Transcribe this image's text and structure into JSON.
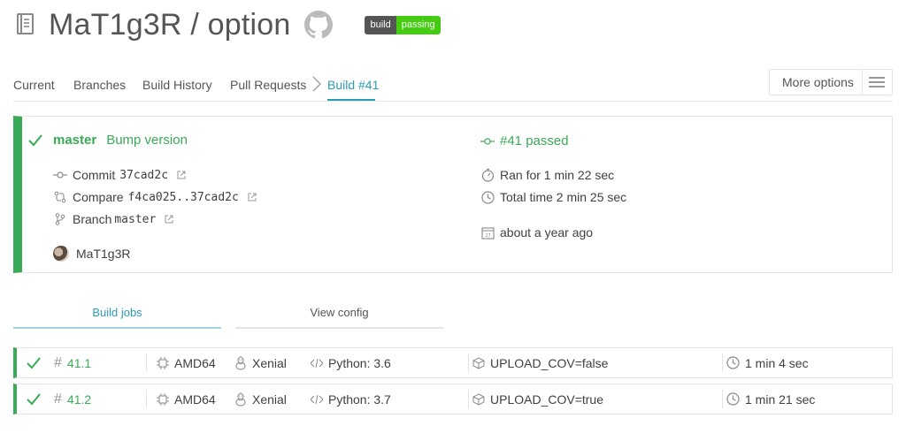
{
  "header": {
    "repo_title": "MaT1g3R / option",
    "badge_left": "build",
    "badge_right": "passing"
  },
  "tabs": {
    "current": "Current",
    "branches": "Branches",
    "build_history": "Build History",
    "pull_requests": "Pull Requests",
    "build": "Build #41",
    "more_options": "More options"
  },
  "build": {
    "branch": "master",
    "message": "Bump version",
    "status": "#41 passed",
    "commit_label": "Commit",
    "commit_sha": "37cad2c",
    "compare_label": "Compare",
    "compare_range": "f4ca025..37cad2c",
    "branch_label": "Branch",
    "branch_value": "master",
    "author": "MaT1g3R",
    "ran_for": "Ran for 1 min 22 sec",
    "total_time": "Total time 2 min 25 sec",
    "finished": "about a year ago"
  },
  "job_tabs": {
    "build_jobs": "Build jobs",
    "view_config": "View config"
  },
  "jobs": [
    {
      "number": "41.1",
      "arch": "AMD64",
      "dist": "Xenial",
      "lang": "Python: 3.6",
      "env": "UPLOAD_COV=false",
      "duration": "1 min 4 sec"
    },
    {
      "number": "41.2",
      "arch": "AMD64",
      "dist": "Xenial",
      "lang": "Python: 3.7",
      "env": "UPLOAD_COV=true",
      "duration": "1 min 21 sec"
    }
  ],
  "colors": {
    "passed": "#39aa56",
    "accent": "#2e9bb5",
    "badge_passing": "#44cc11"
  }
}
